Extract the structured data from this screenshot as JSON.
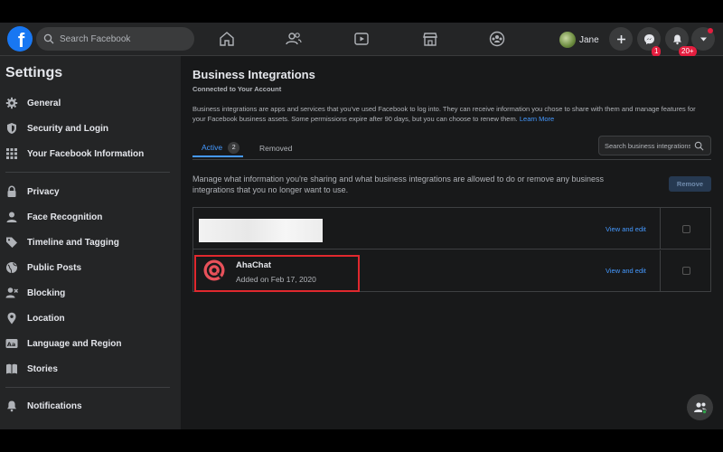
{
  "nav": {
    "logo_letter": "f",
    "search_placeholder": "Search Facebook",
    "profile_name": "Jane",
    "messenger_badge": "1",
    "notifications_badge": "20+",
    "accent_color": "#1877f2"
  },
  "sidebar": {
    "title": "Settings",
    "items": [
      {
        "label": "General",
        "icon": "gear-icon"
      },
      {
        "label": "Security and Login",
        "icon": "shield-icon"
      },
      {
        "label": "Your Facebook Information",
        "icon": "grid-icon"
      },
      {
        "label": "Privacy",
        "icon": "lock-icon"
      },
      {
        "label": "Face Recognition",
        "icon": "face-icon"
      },
      {
        "label": "Timeline and Tagging",
        "icon": "tag-icon"
      },
      {
        "label": "Public Posts",
        "icon": "globe-icon"
      },
      {
        "label": "Blocking",
        "icon": "block-user-icon"
      },
      {
        "label": "Location",
        "icon": "location-pin-icon"
      },
      {
        "label": "Language and Region",
        "icon": "language-icon"
      },
      {
        "label": "Stories",
        "icon": "book-icon"
      },
      {
        "label": "Notifications",
        "icon": "bell-icon"
      }
    ]
  },
  "main": {
    "title": "Business Integrations",
    "subtitle": "Connected to Your Account",
    "description": "Business integrations are apps and services that you've used Facebook to log into. They can receive information you chose to share with them and manage features for your Facebook business assets. Some permissions expire after 90 days, but you can choose to renew them.",
    "learn_more": "Learn More",
    "tabs": {
      "active_label": "Active",
      "active_count": "2",
      "removed_label": "Removed"
    },
    "search_placeholder": "Search business integrations",
    "manage_text": "Manage what information you're sharing and what business integrations are allowed to do or remove any business integrations that you no longer want to use.",
    "remove_label": "Remove",
    "rows": [
      {
        "name": "",
        "date": "",
        "action": "View and edit"
      },
      {
        "name": "AhaChat",
        "date": "Added on Feb 17, 2020",
        "action": "View and edit"
      }
    ]
  }
}
